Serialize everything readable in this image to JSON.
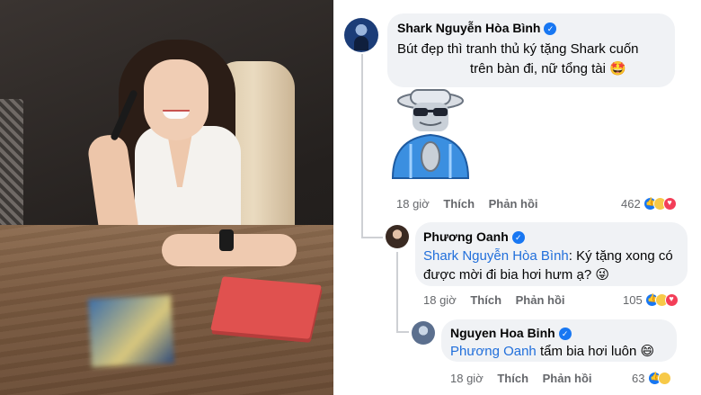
{
  "comments": [
    {
      "author": "Shark Nguyễn Hòa Bình",
      "verified": true,
      "text_line1": "Bút đẹp thì tranh thủ ký tặng Shark cuốn",
      "text_line2": "trên bàn đi, nữ tổng tài",
      "emoji": "🤩",
      "has_sticker": true,
      "time": "18 giờ",
      "like_label": "Thích",
      "reply_label": "Phản hồi",
      "reaction_count": "462",
      "reactions": [
        "like",
        "haha",
        "heart"
      ]
    },
    {
      "author": "Phương Oanh",
      "verified": true,
      "mention": "Shark Nguyễn Hòa Bình",
      "text_line1_rest": ": Ký tặng xong có",
      "text_line2": "được mời đi bia hơi hưm ạ?",
      "emoji": "😜",
      "time": "18 giờ",
      "like_label": "Thích",
      "reply_label": "Phản hồi",
      "reaction_count": "105",
      "reactions": [
        "like",
        "haha",
        "heart"
      ]
    },
    {
      "author": "Nguyen Hoa Binh",
      "verified": true,
      "mention": "Phương Oanh",
      "text_rest": " tẩm bia hơi luôn",
      "emoji": "😄",
      "time": "18 giờ",
      "like_label": "Thích",
      "reply_label": "Phản hồi",
      "reaction_count": "63",
      "reactions": [
        "like",
        "haha"
      ]
    }
  ],
  "colors": {
    "bubble": "#f0f2f5",
    "mention": "#216fdb",
    "meta": "#65676b",
    "verified": "#1877f2"
  },
  "icons": {
    "verified": "verified-badge-icon",
    "like": "like-reaction-icon",
    "haha": "haha-reaction-icon",
    "heart": "love-reaction-icon"
  }
}
